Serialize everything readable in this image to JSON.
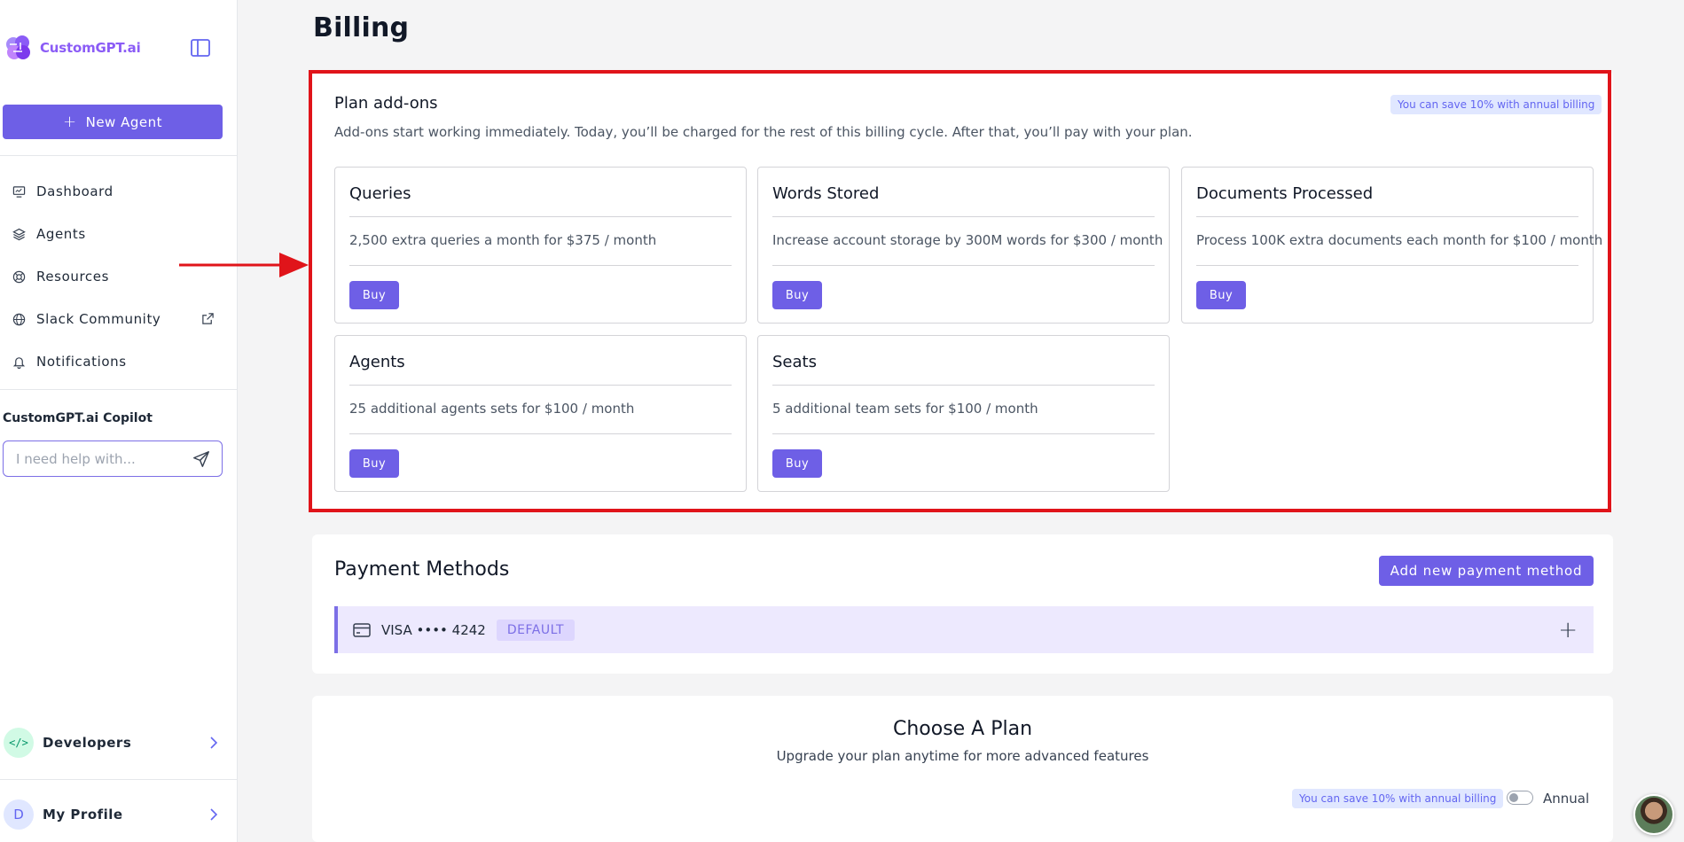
{
  "sidebar": {
    "brand_name": "CustomGPT.ai",
    "new_agent_label": "New Agent",
    "nav": [
      {
        "label": "Dashboard"
      },
      {
        "label": "Agents"
      },
      {
        "label": "Resources"
      },
      {
        "label": "Slack Community"
      },
      {
        "label": "Notifications"
      }
    ],
    "copilot_title": "CustomGPT.ai Copilot",
    "copilot_placeholder": "I need help with...",
    "developers_label": "Developers",
    "profile_label": "My Profile",
    "profile_initial": "D"
  },
  "page": {
    "title": "Billing"
  },
  "addons": {
    "title": "Plan add-ons",
    "description": "Add-ons start working immediately. Today, you’ll be charged for the rest of this billing cycle. After that, you’ll pay with your plan.",
    "save_badge": "You can save 10% with annual billing",
    "cards": [
      {
        "title": "Queries",
        "description": "2,500 extra queries a month for $375 / month",
        "button": "Buy"
      },
      {
        "title": "Words Stored",
        "description": "Increase account storage by 300M words for $300 / month",
        "button": "Buy"
      },
      {
        "title": "Documents Processed",
        "description": "Process 100K extra documents each month for $100 / month",
        "button": "Buy"
      },
      {
        "title": "Agents",
        "description": "25 additional agents sets for $100 / month",
        "button": "Buy"
      },
      {
        "title": "Seats",
        "description": "5 additional team sets for $100 / month",
        "button": "Buy"
      }
    ]
  },
  "payment": {
    "title": "Payment Methods",
    "add_button": "Add new payment method",
    "card_text": "VISA •••• 4242",
    "default_badge": "DEFAULT"
  },
  "plan": {
    "title": "Choose A Plan",
    "subtitle": "Upgrade your plan anytime for more advanced features",
    "save_badge": "You can save 10% with annual billing",
    "toggle_label": "Annual",
    "annual_enabled": false
  },
  "colors": {
    "accent": "#6e5fe6",
    "highlight": "#e0141a",
    "brand": "#8b5cf6"
  }
}
